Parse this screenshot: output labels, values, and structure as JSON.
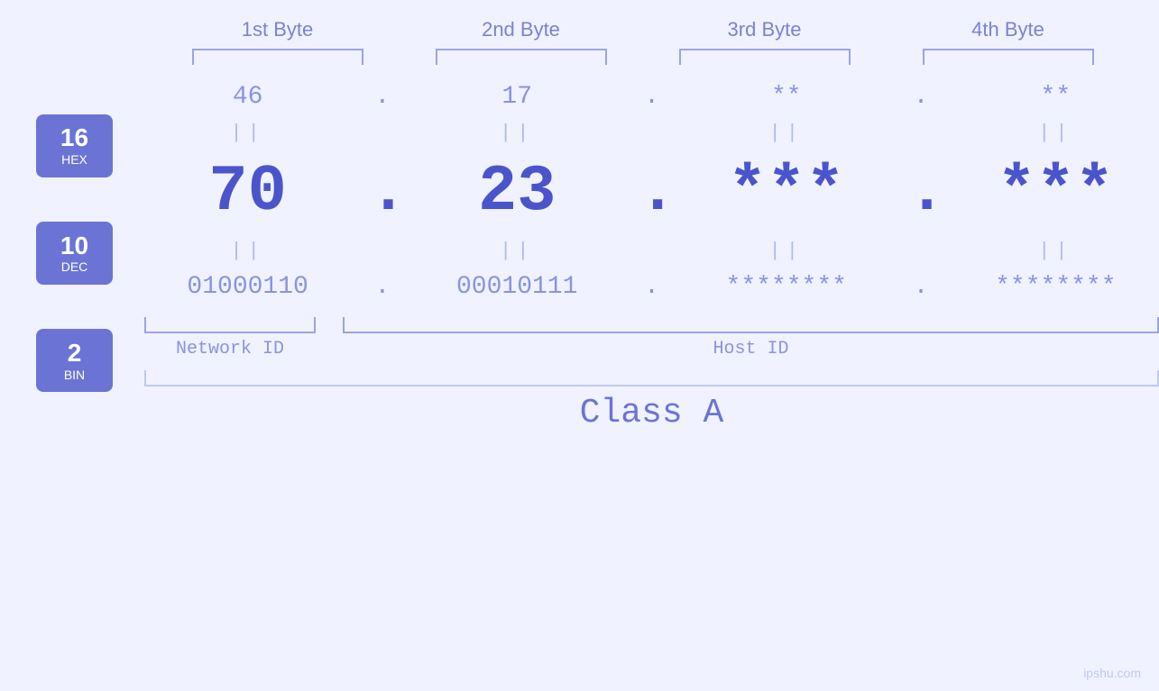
{
  "headers": {
    "byte1": "1st Byte",
    "byte2": "2nd Byte",
    "byte3": "3rd Byte",
    "byte4": "4th Byte"
  },
  "bases": [
    {
      "num": "16",
      "name": "HEX"
    },
    {
      "num": "10",
      "name": "DEC"
    },
    {
      "num": "2",
      "name": "BIN"
    }
  ],
  "rows": {
    "hex": {
      "b1": "46",
      "b2": "17",
      "b3": "**",
      "b4": "**"
    },
    "dec": {
      "b1": "70",
      "b2": "23",
      "b3": "***",
      "b4": "***"
    },
    "bin": {
      "b1": "01000110",
      "b2": "00010111",
      "b3": "********",
      "b4": "********"
    }
  },
  "separators": {
    "hex": "||",
    "dec": "||",
    "bin": "||"
  },
  "labels": {
    "network_id": "Network ID",
    "host_id": "Host ID",
    "class": "Class A"
  },
  "watermark": "ipshu.com"
}
